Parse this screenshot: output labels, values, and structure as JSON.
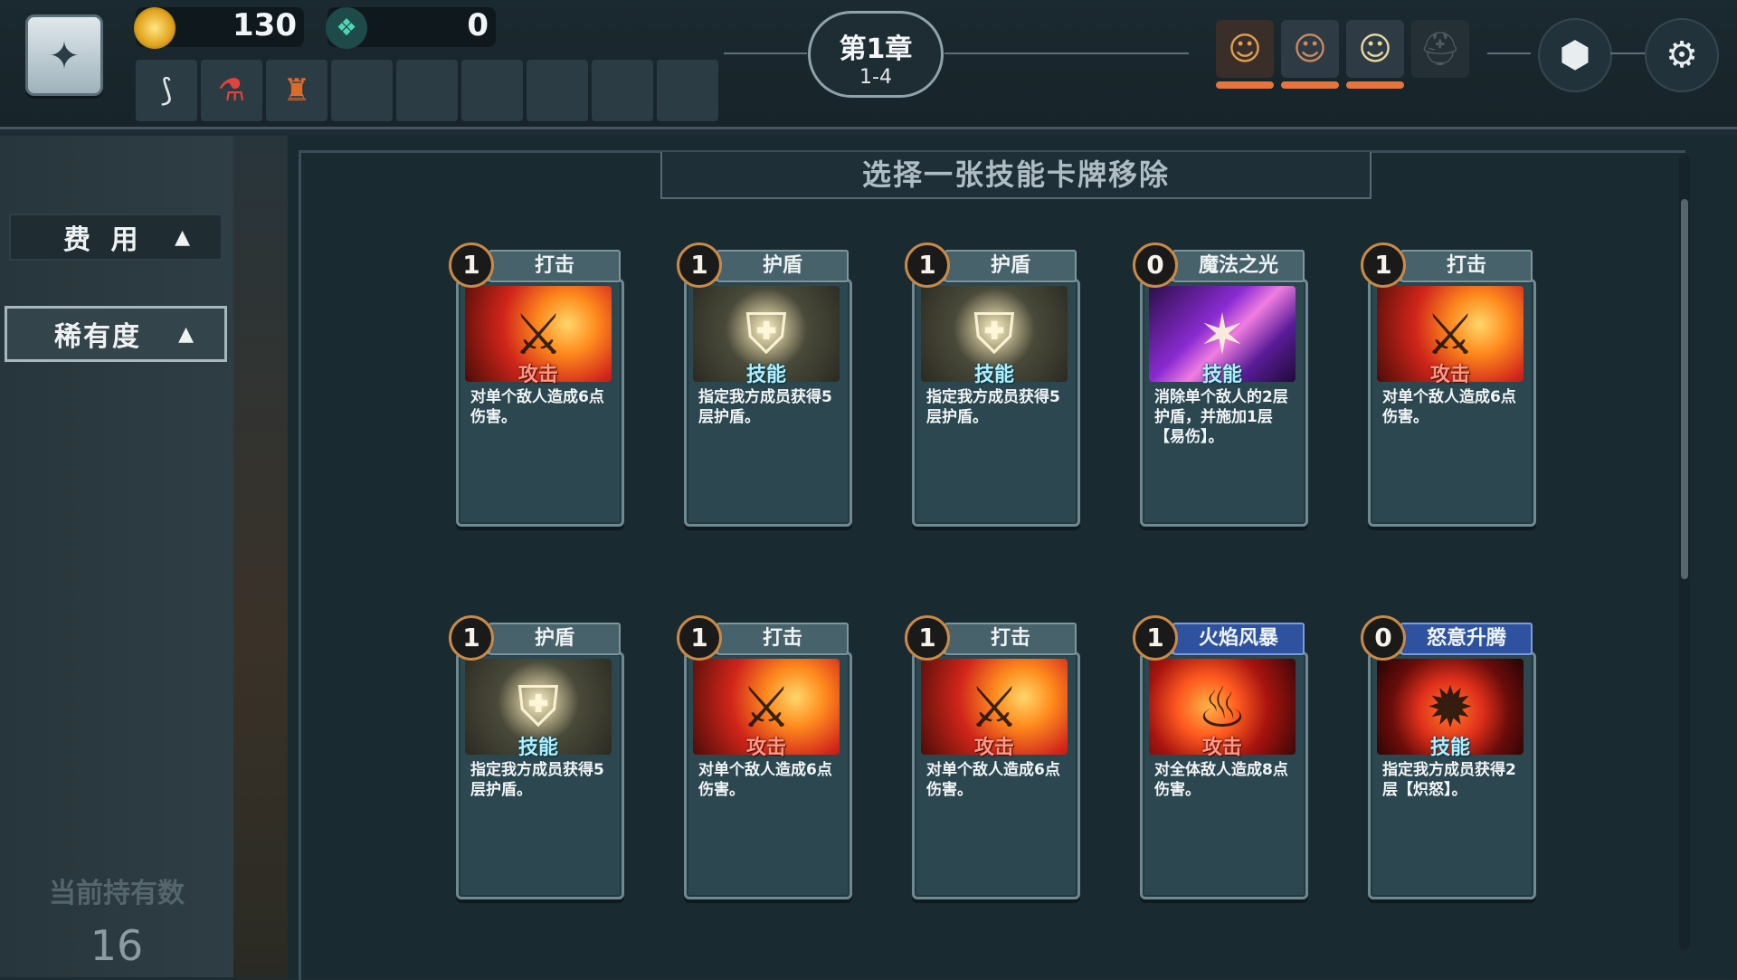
{
  "resources": {
    "gold": "130",
    "gems": "0",
    "gold_icon": "gold-coin-icon",
    "gem_icon": "diamond-gem-icon"
  },
  "relics": [
    "horn-relic-icon",
    "red-potion-icon",
    "lantern-relic-icon",
    "",
    "",
    "",
    "",
    "",
    ""
  ],
  "chapter": {
    "title": "第1章",
    "stage": "1-4"
  },
  "party": [
    {
      "icon": "hero-portrait-redhair-icon",
      "hp_fraction": 1.0
    },
    {
      "icon": "hero-portrait-brownhair-icon",
      "hp_fraction": 1.0
    },
    {
      "icon": "hero-portrait-blonde-icon",
      "hp_fraction": 1.0
    },
    {
      "icon": "locked-knight-helmet-icon",
      "hp_fraction": null
    }
  ],
  "sidebar": {
    "filters": [
      {
        "label": "费 用",
        "arrow": "▲",
        "active": false
      },
      {
        "label": "稀有度",
        "arrow": "▲",
        "active": true
      }
    ],
    "count_label": "当前持有数",
    "count_value": "16"
  },
  "prompt": "选择一张技能卡牌移除",
  "cards": [
    {
      "cost": "1",
      "name": "打击",
      "type": "攻击",
      "art": "attack",
      "rarity": "common",
      "desc": "对单个敌人造成6点伤害。"
    },
    {
      "cost": "1",
      "name": "护盾",
      "type": "技能",
      "art": "shield",
      "rarity": "common",
      "desc": "指定我方成员获得5层护盾。"
    },
    {
      "cost": "1",
      "name": "护盾",
      "type": "技能",
      "art": "shield",
      "rarity": "common",
      "desc": "指定我方成员获得5层护盾。"
    },
    {
      "cost": "0",
      "name": "魔法之光",
      "type": "技能",
      "art": "magic",
      "rarity": "common",
      "desc": "消除单个敌人的2层护盾，并施加1层【易伤】。"
    },
    {
      "cost": "1",
      "name": "打击",
      "type": "攻击",
      "art": "attack",
      "rarity": "common",
      "desc": "对单个敌人造成6点伤害。"
    },
    {
      "cost": "1",
      "name": "护盾",
      "type": "技能",
      "art": "shield",
      "rarity": "common",
      "desc": "指定我方成员获得5层护盾。"
    },
    {
      "cost": "1",
      "name": "打击",
      "type": "攻击",
      "art": "attack",
      "rarity": "common",
      "desc": "对单个敌人造成6点伤害。"
    },
    {
      "cost": "1",
      "name": "打击",
      "type": "攻击",
      "art": "attack",
      "rarity": "common",
      "desc": "对单个敌人造成6点伤害。"
    },
    {
      "cost": "1",
      "name": "火焰风暴",
      "type": "攻击",
      "art": "fire",
      "rarity": "rare",
      "desc": "对全体敌人造成8点伤害。"
    },
    {
      "cost": "0",
      "name": "怒意升腾",
      "type": "技能",
      "art": "rage",
      "rarity": "rare",
      "desc": "指定我方成员获得2层【炽怒】。"
    }
  ],
  "colors": {
    "background": "#1a2a31",
    "card_body": "#2c4750",
    "rare_namebar": "#2f52a0",
    "cost_ring": "#c98a45",
    "hp_bar": "#e8743a"
  }
}
